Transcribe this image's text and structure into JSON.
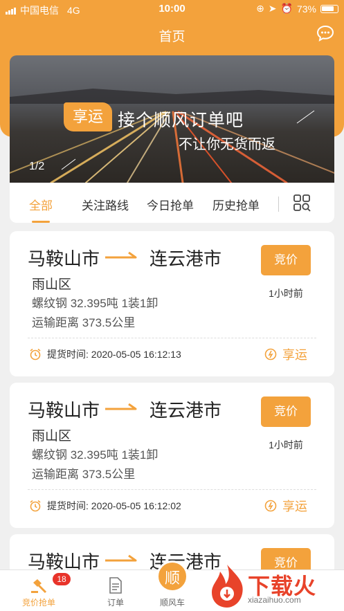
{
  "status_bar": {
    "carrier": "中国电信",
    "network": "4G",
    "time": "10:00",
    "battery": "73%"
  },
  "header": {
    "title": "首页"
  },
  "banner": {
    "tag": "享运",
    "headline": "接个顺风订单吧",
    "subline": "不让你无货而返",
    "pager": "1/2"
  },
  "tabs": [
    {
      "label": "全部"
    },
    {
      "label": "关注路线"
    },
    {
      "label": "今日抢单"
    },
    {
      "label": "历史抢单"
    }
  ],
  "orders": [
    {
      "from": "马鞍山市",
      "to": "连云港市",
      "district": "雨山区",
      "goods": "螺纹钢 32.395吨 1装1卸",
      "distance": "运输距离 373.5公里",
      "bid_label": "竞价",
      "ago": "1小时前",
      "pickup_time": "提货时间: 2020-05-05 16:12:13",
      "brand": "享运"
    },
    {
      "from": "马鞍山市",
      "to": "连云港市",
      "district": "雨山区",
      "goods": "螺纹钢 32.395吨 1装1卸",
      "distance": "运输距离 373.5公里",
      "bid_label": "竞价",
      "ago": "1小时前",
      "pickup_time": "提货时间: 2020-05-05 16:12:02",
      "brand": "享运"
    },
    {
      "from": "马鞍山市",
      "to": "连云港市",
      "bid_label": "竞价"
    }
  ],
  "bottom_nav": {
    "items": [
      {
        "label": "竞价抢单",
        "badge": "18"
      },
      {
        "label": "订单"
      },
      {
        "label": "顺风车",
        "center": "顺"
      }
    ]
  },
  "watermark": {
    "text": "下载火",
    "sub": "xiazaihuo.com"
  },
  "colors": {
    "accent": "#f3a23c",
    "badge": "#e8332a"
  }
}
